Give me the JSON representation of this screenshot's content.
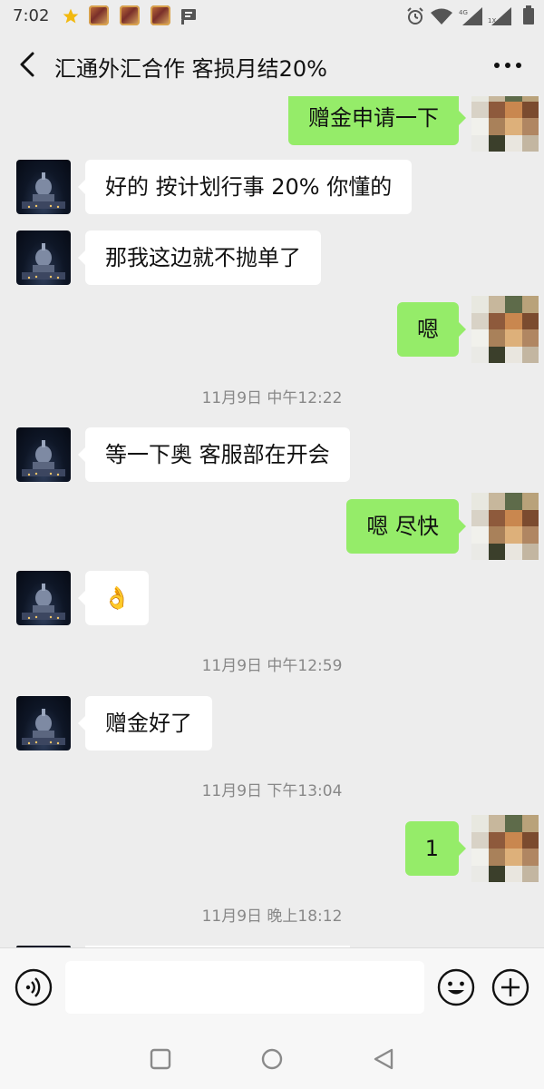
{
  "status_bar": {
    "time": "7:02",
    "star_icon": "star-icon",
    "notification_icons": [
      "game-hero-icon",
      "game-hero-icon",
      "game-hero-icon",
      "flag-icon"
    ],
    "right_icons": [
      "alarm-icon",
      "wifi-icon",
      "signal-4g-icon",
      "signal-1x-icon",
      "battery-icon"
    ],
    "signal_labels": {
      "net_4g": "4G",
      "net_1x": "1X"
    }
  },
  "header": {
    "title": "汇通外汇合作 客损月结20%",
    "back_icon": "chevron-left-icon",
    "more_icon": "more-horizontal-icon"
  },
  "messages": [
    {
      "type": "message",
      "side": "right",
      "text": "赠金申请一下"
    },
    {
      "type": "message",
      "side": "left",
      "text": "好的 按计划行事 20% 你懂的"
    },
    {
      "type": "message",
      "side": "left",
      "text": "那我这边就不抛单了"
    },
    {
      "type": "message",
      "side": "right",
      "text": "嗯"
    },
    {
      "type": "timestamp",
      "text": "11月9日 中午12:22"
    },
    {
      "type": "message",
      "side": "left",
      "text": "等一下奥 客服部在开会"
    },
    {
      "type": "message",
      "side": "right",
      "text": "嗯 尽快"
    },
    {
      "type": "message",
      "side": "left",
      "text": "👌"
    },
    {
      "type": "timestamp",
      "text": "11月9日 中午12:59"
    },
    {
      "type": "message",
      "side": "left",
      "text": "赠金好了"
    },
    {
      "type": "timestamp",
      "text": "11月9日 下午13:04"
    },
    {
      "type": "message",
      "side": "right",
      "text": "1"
    },
    {
      "type": "timestamp",
      "text": "11月9日 晚上18:12"
    }
  ],
  "input_bar": {
    "voice_icon": "voice-icon",
    "input_value": "",
    "emoji_icon": "emoji-icon",
    "plus_icon": "plus-circle-icon"
  },
  "nav_bar": {
    "buttons": [
      "recents-square-icon",
      "home-circle-icon",
      "back-triangle-icon"
    ]
  },
  "colors": {
    "background": "#ededed",
    "bubble_sent": "#95ec69",
    "bubble_received": "#ffffff",
    "timestamp_text": "#888888"
  }
}
